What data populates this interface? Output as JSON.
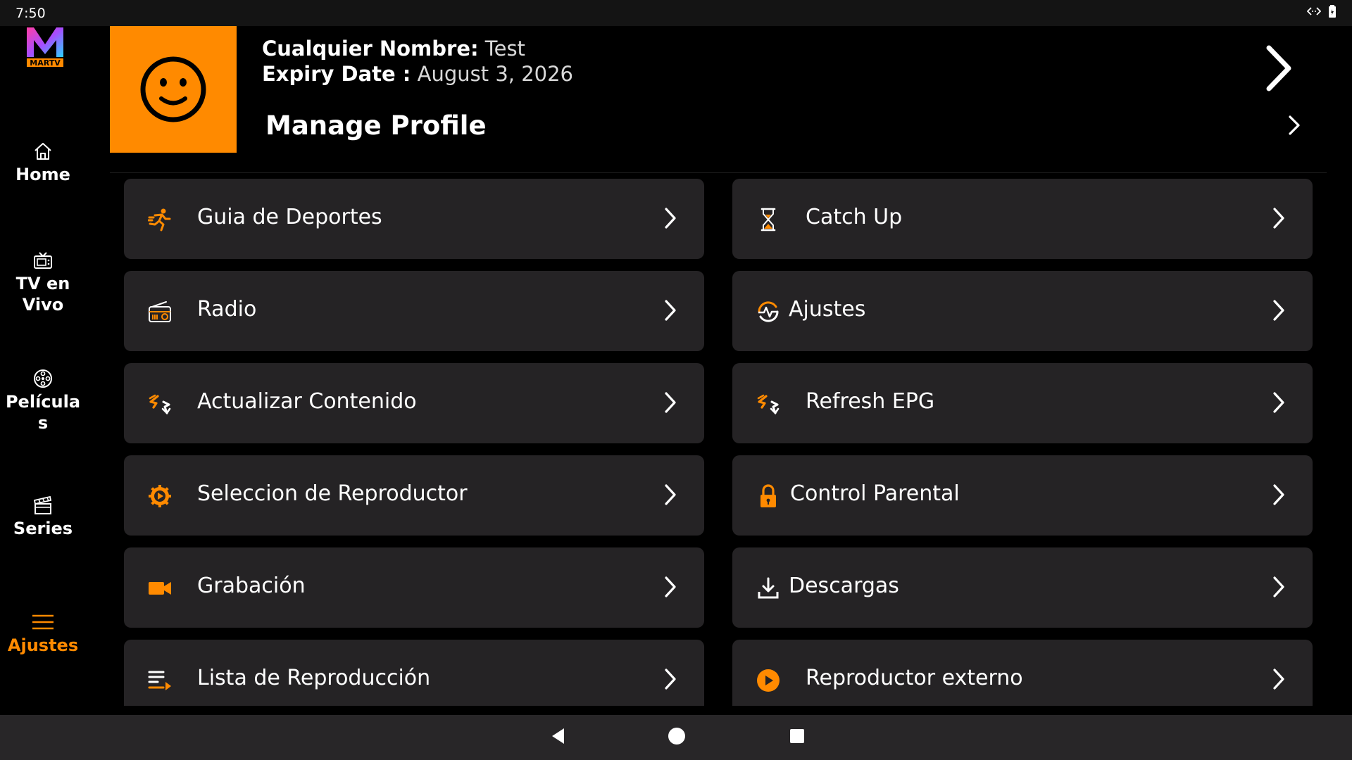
{
  "status": {
    "time": "7:50"
  },
  "sidebar": {
    "logo_text": "MARTV",
    "items": [
      {
        "label": "Home",
        "icon": "home-icon"
      },
      {
        "label": "TV en Vivo",
        "icon": "tv-icon"
      },
      {
        "label": "Película s",
        "icon": "film-reel-icon"
      },
      {
        "label": "Series",
        "icon": "clapperboard-icon"
      },
      {
        "label": "Ajustes",
        "icon": "menu-icon",
        "active": true
      }
    ]
  },
  "profile": {
    "name_label": "Cualquier Nombre:",
    "name_value": " Test",
    "expiry_label": "Expiry Date :",
    "expiry_value": " August 3, 2026",
    "manage_label": "Manage Profile",
    "avatar_icon": "smiley-face-icon"
  },
  "settings": {
    "left": [
      {
        "label": "Guia de Deportes",
        "icon": "running-person-icon"
      },
      {
        "label": "Radio",
        "icon": "radio-icon"
      },
      {
        "label": "Actualizar Contenido",
        "icon": "refresh-arrows-icon"
      },
      {
        "label": "Seleccion de Reproductor",
        "icon": "player-gear-icon"
      },
      {
        "label": "Grabación",
        "icon": "video-camera-icon"
      },
      {
        "label": "Lista de Reproducción",
        "icon": "playlist-icon"
      }
    ],
    "right": [
      {
        "label": "Catch Up",
        "icon": "hourglass-icon"
      },
      {
        "label": "Ajustes",
        "icon": "settings-pulse-icon"
      },
      {
        "label": "Refresh EPG",
        "icon": "refresh-arrows-icon"
      },
      {
        "label": "Control Parental",
        "icon": "lock-icon"
      },
      {
        "label": "Descargas",
        "icon": "download-icon"
      },
      {
        "label": "Reproductor externo",
        "icon": "play-circle-icon"
      }
    ]
  },
  "colors": {
    "accent": "#ff8a00",
    "card": "#252325",
    "background": "#000000"
  }
}
